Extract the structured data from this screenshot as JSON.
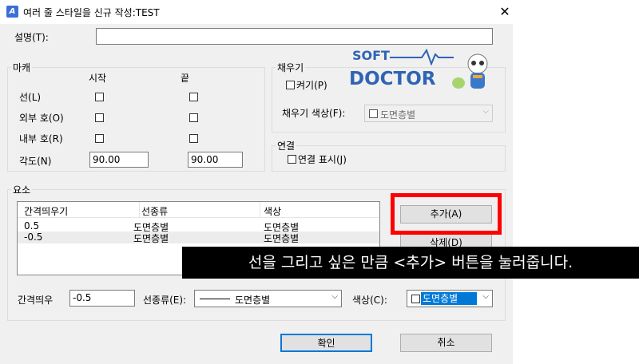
{
  "window": {
    "title": "여러 줄 스타일을 신규 작성:TEST",
    "close": "✕"
  },
  "description": {
    "label": "설명(T):",
    "value": ""
  },
  "caps": {
    "title": "마캐",
    "col_start": "시작",
    "col_end": "끝",
    "rows": [
      {
        "label": "선(L)",
        "start": false,
        "end": false
      },
      {
        "label": "외부 호(O)",
        "start": false,
        "end": false
      },
      {
        "label": "내부 호(R)",
        "start": false,
        "end": false
      }
    ],
    "angle_label": "각도(N)",
    "angle_start": "90.00",
    "angle_end": "90.00"
  },
  "fill": {
    "title": "채우기",
    "on_label": "켜기(P)",
    "color_label": "채우기 색상(F):",
    "color_value": "도면층별"
  },
  "logo": {
    "top": "SOFT",
    "bottom": "DOCTOR"
  },
  "joints": {
    "title": "연결",
    "display_label": "연결 표시(J)"
  },
  "elements": {
    "title": "요소",
    "headers": [
      "간격띄우기",
      "선종류",
      "색상"
    ],
    "rows": [
      {
        "offset": "0.5",
        "linetype": "도면층별",
        "color": "도면층별"
      },
      {
        "offset": "-0.5",
        "linetype": "도면층별",
        "color": "도면층별"
      }
    ],
    "add_button": "추가(A)",
    "delete_button": "삭제(D)",
    "offset_label": "간격띄우",
    "offset_value": "-0.5",
    "linetype_label": "선종류(E):",
    "linetype_value": "도면층별",
    "color_label": "색상(C):",
    "color_value": "도면층별"
  },
  "buttons": {
    "ok": "확인",
    "cancel": "취소"
  },
  "caption": "선을 그리고 싶은 만큼 <추가> 버튼을 눌러줍니다.",
  "colors": {
    "highlight": "#ff0000",
    "selection": "#0078d7",
    "logo_blue": "#2f64b5"
  }
}
